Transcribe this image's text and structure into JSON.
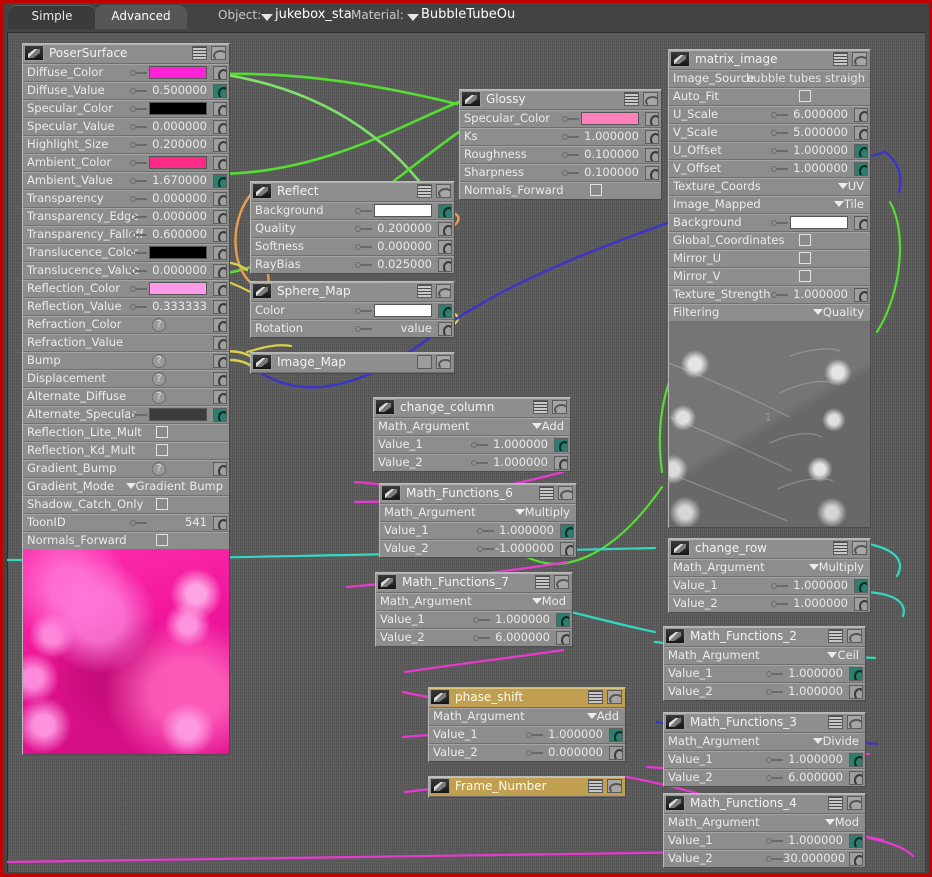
{
  "window": {
    "border_color": "#c10000",
    "background_color": "#595959"
  },
  "topbar": {
    "tabs": [
      {
        "label": "Simple",
        "active": false
      },
      {
        "label": "Advanced",
        "active": true
      }
    ],
    "object_label": "Object:",
    "object_value": "jukebox_sta",
    "material_label": "Material:",
    "material_value": "BubbleTubeOu"
  },
  "nodes": {
    "poser_surface": {
      "title": "PoserSurface",
      "rows": [
        {
          "label": "Diffuse_Color",
          "type": "color",
          "value": "#ff22d8"
        },
        {
          "label": "Diffuse_Value",
          "type": "number",
          "value": "0.500000",
          "connected": true
        },
        {
          "label": "Specular_Color",
          "type": "color",
          "value": "#000000"
        },
        {
          "label": "Specular_Value",
          "type": "number",
          "value": "0.000000"
        },
        {
          "label": "Highlight_Size",
          "type": "number",
          "value": "0.200000"
        },
        {
          "label": "Ambient_Color",
          "type": "color",
          "value": "#ff2a86"
        },
        {
          "label": "Ambient_Value",
          "type": "number",
          "value": "1.670000",
          "connected": true
        },
        {
          "label": "Transparency",
          "type": "number",
          "value": "0.000000"
        },
        {
          "label": "Transparency_Edge",
          "type": "number",
          "value": "0.000000"
        },
        {
          "label": "Transparency_Falloff",
          "type": "number",
          "value": "0.600000"
        },
        {
          "label": "Translucence_Color",
          "type": "color",
          "value": "#000000"
        },
        {
          "label": "Translucence_Value",
          "type": "number",
          "value": "0.000000"
        },
        {
          "label": "Reflection_Color",
          "type": "color",
          "value": "#ff9ae8"
        },
        {
          "label": "Reflection_Value",
          "type": "number",
          "value": "0.333333"
        },
        {
          "label": "Refraction_Color",
          "type": "empty",
          "value": "?"
        },
        {
          "label": "Refraction_Value",
          "type": "blank",
          "value": ""
        },
        {
          "label": "Bump",
          "type": "empty",
          "value": "?"
        },
        {
          "label": "Displacement",
          "type": "empty",
          "value": "?"
        },
        {
          "label": "Alternate_Diffuse",
          "type": "empty",
          "value": "?"
        },
        {
          "label": "Alternate_Specular",
          "type": "color",
          "value": "#3c3c3c",
          "connected": true
        },
        {
          "label": "Reflection_Lite_Mult",
          "type": "check",
          "value": ""
        },
        {
          "label": "Reflection_Kd_Mult",
          "type": "check",
          "value": ""
        },
        {
          "label": "Gradient_Bump",
          "type": "empty",
          "value": "?"
        },
        {
          "label": "Gradient_Mode",
          "type": "menu",
          "value": "Gradient Bump"
        },
        {
          "label": "Shadow_Catch_Only",
          "type": "check",
          "value": ""
        },
        {
          "label": "ToonID",
          "type": "number",
          "value": "541"
        },
        {
          "label": "Normals_Forward",
          "type": "check",
          "value": ""
        }
      ],
      "preview": "pink-bubble-texture"
    },
    "glossy": {
      "title": "Glossy",
      "rows": [
        {
          "label": "Specular_Color",
          "type": "color",
          "value": "#ff82bc"
        },
        {
          "label": "Ks",
          "type": "number",
          "value": "1.000000"
        },
        {
          "label": "Roughness",
          "type": "number",
          "value": "0.100000"
        },
        {
          "label": "Sharpness",
          "type": "number",
          "value": "0.100000"
        },
        {
          "label": "Normals_Forward",
          "type": "check",
          "value": ""
        }
      ]
    },
    "reflect": {
      "title": "Reflect",
      "rows": [
        {
          "label": "Background",
          "type": "white",
          "value": "",
          "connected": true
        },
        {
          "label": "Quality",
          "type": "number",
          "value": "0.200000"
        },
        {
          "label": "Softness",
          "type": "number",
          "value": "0.000000"
        },
        {
          "label": "RayBias",
          "type": "number",
          "value": "0.025000"
        }
      ]
    },
    "sphere_map": {
      "title": "Sphere_Map",
      "rows": [
        {
          "label": "Color",
          "type": "white",
          "value": "",
          "connected": true
        },
        {
          "label": "Rotation",
          "type": "text",
          "value": "value"
        }
      ]
    },
    "image_map": {
      "title": "Image_Map",
      "collapsed": true
    },
    "matrix_image": {
      "title": "matrix_image",
      "rows": [
        {
          "label": "Image_Source",
          "type": "source",
          "value": "bubble tubes straight"
        },
        {
          "label": "Auto_Fit",
          "type": "check",
          "value": ""
        },
        {
          "label": "U_Scale",
          "type": "number",
          "value": "6.000000"
        },
        {
          "label": "V_Scale",
          "type": "number",
          "value": "5.000000"
        },
        {
          "label": "U_Offset",
          "type": "number",
          "value": "1.000000",
          "connected": true
        },
        {
          "label": "V_Offset",
          "type": "number",
          "value": "1.000000",
          "connected": true
        },
        {
          "label": "Texture_Coords",
          "type": "menu",
          "value": "UV"
        },
        {
          "label": "Image_Mapped",
          "type": "menu",
          "value": "Tile"
        },
        {
          "label": "Background",
          "type": "white",
          "value": ""
        },
        {
          "label": "Global_Coordinates",
          "type": "check",
          "value": ""
        },
        {
          "label": "Mirror_U",
          "type": "check",
          "value": ""
        },
        {
          "label": "Mirror_V",
          "type": "check",
          "value": ""
        },
        {
          "label": "Texture_Strength",
          "type": "number",
          "value": "1.000000"
        },
        {
          "label": "Filtering",
          "type": "menu",
          "value": "Quality"
        }
      ],
      "preview": "gray-bubble-texture"
    },
    "change_column": {
      "title": "change_column",
      "rows": [
        {
          "label": "Math_Argument",
          "type": "menu",
          "value": "Add"
        },
        {
          "label": "Value_1",
          "type": "number",
          "value": "1.000000",
          "connected": true
        },
        {
          "label": "Value_2",
          "type": "number",
          "value": "1.000000"
        }
      ]
    },
    "math_functions_6": {
      "title": "Math_Functions_6",
      "rows": [
        {
          "label": "Math_Argument",
          "type": "menu",
          "value": "Multiply"
        },
        {
          "label": "Value_1",
          "type": "number",
          "value": "1.000000",
          "connected": true
        },
        {
          "label": "Value_2",
          "type": "number",
          "value": "-1.000000"
        }
      ]
    },
    "math_functions_7": {
      "title": "Math_Functions_7",
      "rows": [
        {
          "label": "Math_Argument",
          "type": "menu",
          "value": "Mod"
        },
        {
          "label": "Value_1",
          "type": "number",
          "value": "1.000000",
          "connected": true
        },
        {
          "label": "Value_2",
          "type": "number",
          "value": "6.000000"
        }
      ]
    },
    "phase_shift": {
      "title": "phase_shift",
      "selected": true,
      "rows": [
        {
          "label": "Math_Argument",
          "type": "menu",
          "value": "Add"
        },
        {
          "label": "Value_1",
          "type": "number",
          "value": "1.000000",
          "connected": true
        },
        {
          "label": "Value_2",
          "type": "number",
          "value": "0.000000"
        }
      ]
    },
    "frame_number": {
      "title": "Frame_Number",
      "selected": true,
      "collapsed": true
    },
    "change_row": {
      "title": "change_row",
      "rows": [
        {
          "label": "Math_Argument",
          "type": "menu",
          "value": "Multiply"
        },
        {
          "label": "Value_1",
          "type": "number",
          "value": "1.000000",
          "connected": true
        },
        {
          "label": "Value_2",
          "type": "number",
          "value": "1.000000"
        }
      ]
    },
    "math_functions_2": {
      "title": "Math_Functions_2",
      "rows": [
        {
          "label": "Math_Argument",
          "type": "menu",
          "value": "Ceil"
        },
        {
          "label": "Value_1",
          "type": "number",
          "value": "1.000000",
          "connected": true
        },
        {
          "label": "Value_2",
          "type": "number",
          "value": "1.000000"
        }
      ]
    },
    "math_functions_3": {
      "title": "Math_Functions_3",
      "rows": [
        {
          "label": "Math_Argument",
          "type": "menu",
          "value": "Divide"
        },
        {
          "label": "Value_1",
          "type": "number",
          "value": "1.000000",
          "connected": true
        },
        {
          "label": "Value_2",
          "type": "number",
          "value": "6.000000"
        }
      ]
    },
    "math_functions_4": {
      "title": "Math_Functions_4",
      "rows": [
        {
          "label": "Math_Argument",
          "type": "menu",
          "value": "Mod"
        },
        {
          "label": "Value_1",
          "type": "number",
          "value": "1.000000",
          "connected": true
        },
        {
          "label": "Value_2",
          "type": "number",
          "value": "30.000000"
        }
      ]
    }
  },
  "wire_colors": {
    "green": "#55dd33",
    "orange": "#e8a050",
    "yellow": "#d8d14a",
    "blue": "#3a34c8",
    "magenta": "#e83ad0",
    "cyan": "#33d8c0",
    "lightgreen": "#7fe06a"
  }
}
